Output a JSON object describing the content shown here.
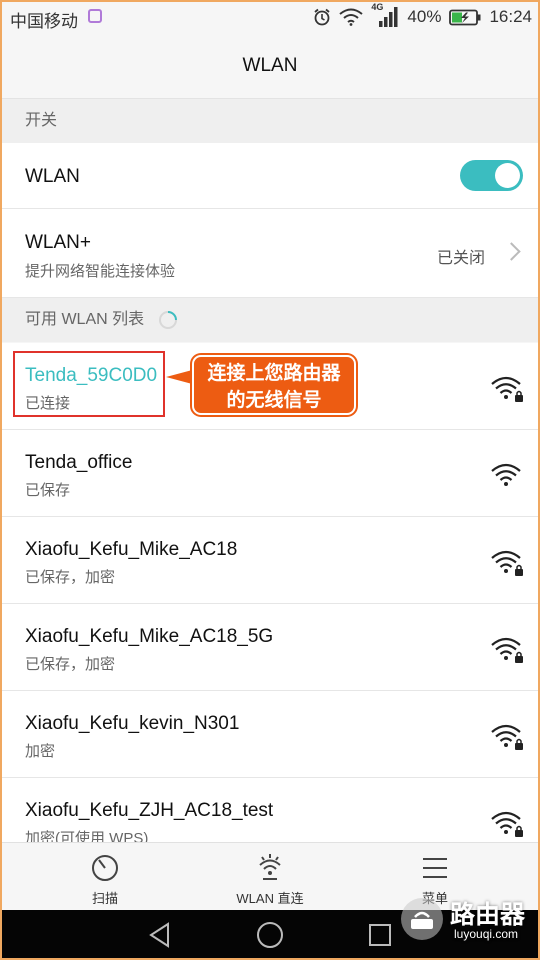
{
  "status": {
    "carrier": "中国移动",
    "network": "4G",
    "battery": "40%",
    "time": "16:24"
  },
  "title": "WLAN",
  "switch_section": "开关",
  "wlan_row": {
    "label": "WLAN",
    "toggle_on": true
  },
  "wlan_plus": {
    "label": "WLAN+",
    "sub": "提升网络智能连接体验",
    "status": "已关闭"
  },
  "list_section": "可用 WLAN 列表",
  "networks": [
    {
      "name": "Tenda_59C0D0",
      "status": "已连接",
      "connected": true
    },
    {
      "name": "Tenda_office",
      "status": "已保存",
      "connected": false
    },
    {
      "name": "Xiaofu_Kefu_Mike_AC18",
      "status": "已保存，加密",
      "connected": false
    },
    {
      "name": "Xiaofu_Kefu_Mike_AC18_5G",
      "status": "已保存，加密",
      "connected": false
    },
    {
      "name": "Xiaofu_Kefu_kevin_N301",
      "status": "加密",
      "connected": false
    },
    {
      "name": "Xiaofu_Kefu_ZJH_AC18_test",
      "status": "加密(可使用 WPS)",
      "connected": false
    }
  ],
  "callout": {
    "line1": "连接上您路由器",
    "line2": "的无线信号"
  },
  "tabs": [
    {
      "label": "扫描"
    },
    {
      "label": "WLAN 直连"
    },
    {
      "label": "菜单"
    }
  ],
  "watermark": {
    "name": "路由器",
    "site": "luyouqi.com"
  },
  "colors": {
    "accent": "#3bbdc0",
    "callout": "#ed5c12",
    "highlight": "#e0322b"
  }
}
